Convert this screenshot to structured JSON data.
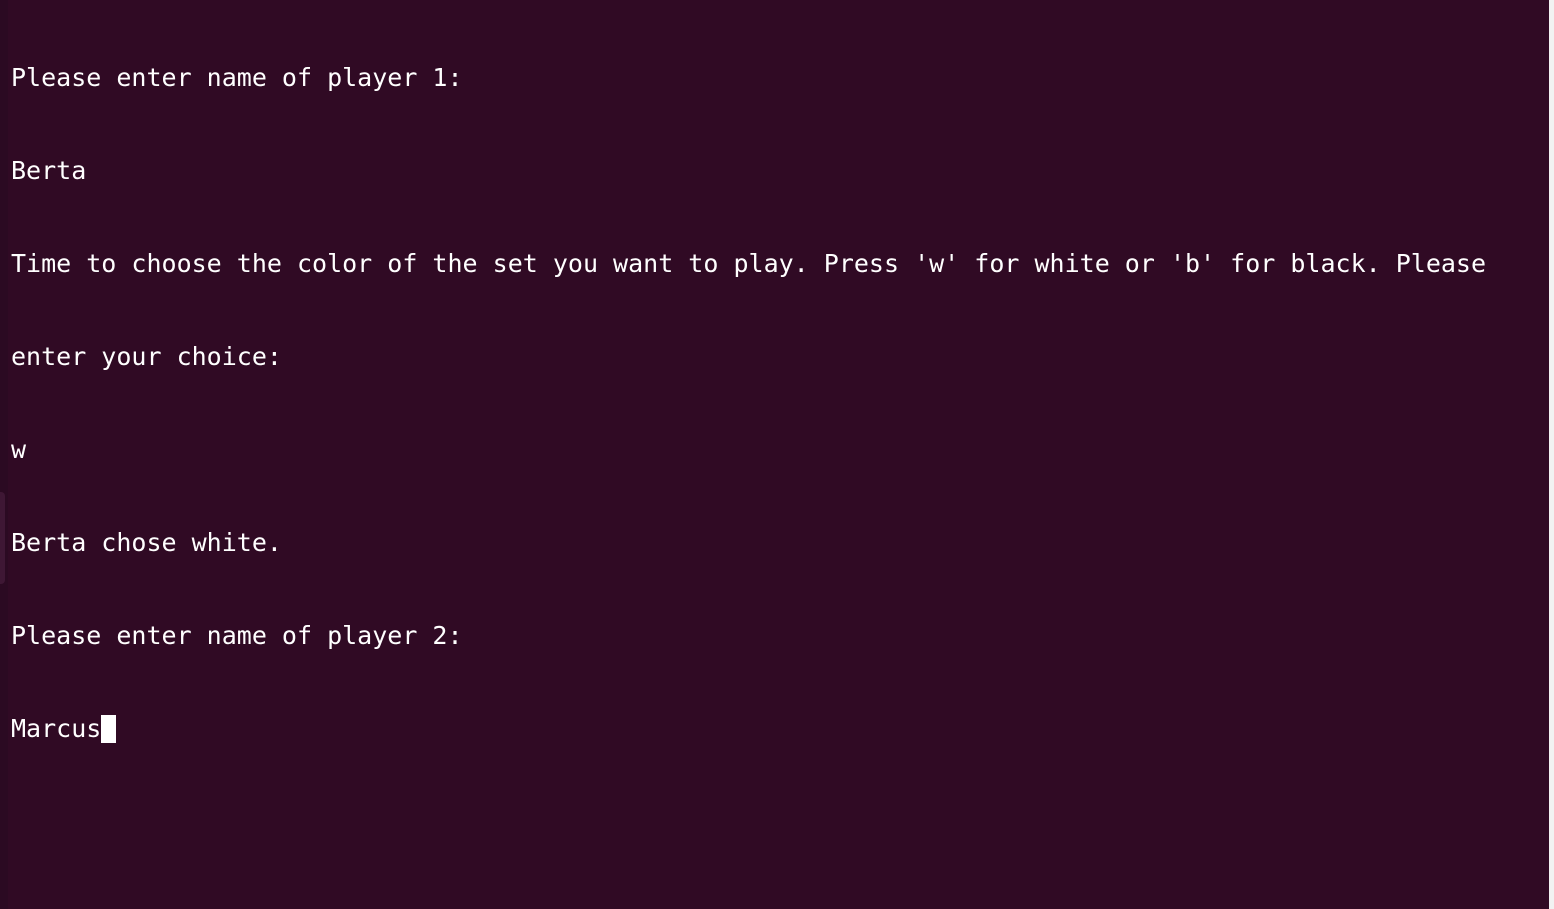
{
  "terminal": {
    "lines": [
      "Please enter name of player 1:",
      "Berta",
      "Time to choose the color of the set you want to play. Press 'w' for white or 'b' for black. Please",
      "enter your choice:",
      "w",
      "Berta chose white.",
      "Please enter name of player 2:"
    ],
    "current_input": "Marcus"
  },
  "colors": {
    "background": "#300a24",
    "foreground": "#ffffff"
  }
}
